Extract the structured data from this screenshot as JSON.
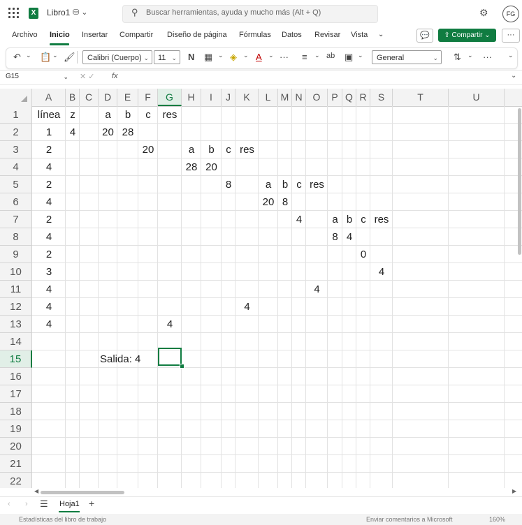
{
  "title_bar": {
    "app_badge": "X",
    "doc_name": "Libro1",
    "doc_status_icons": "⛁ ⌄",
    "search_placeholder": "Buscar herramientas, ayuda y mucho más (Alt + Q)",
    "avatar_initials": "FG"
  },
  "menu": {
    "tabs": [
      "Archivo",
      "Inicio",
      "Insertar",
      "Compartir",
      "Diseño de página",
      "Fórmulas",
      "Datos",
      "Revisar",
      "Vista"
    ],
    "active_tab": "Inicio",
    "share_label": "Compartir",
    "comment_icon": "💬",
    "more_label": "···"
  },
  "ribbon": {
    "font_name": "Calibri (Cuerpo)",
    "font_size": "11",
    "bold_label": "N",
    "number_format": "General",
    "undo_icon": "↶",
    "more_label": "···"
  },
  "formula_bar": {
    "name_box": "G15",
    "cancel_enter_icons": "✕  ✓",
    "fx_label": "fx",
    "content": ""
  },
  "sheet": {
    "columns": [
      "A",
      "B",
      "C",
      "D",
      "E",
      "F",
      "G",
      "H",
      "I",
      "J",
      "K",
      "L",
      "M",
      "N",
      "O",
      "P",
      "Q",
      "R",
      "S",
      "T",
      "U"
    ],
    "rows": [
      "1",
      "2",
      "3",
      "4",
      "5",
      "6",
      "7",
      "8",
      "9",
      "10",
      "11",
      "12",
      "13",
      "14",
      "15",
      "16",
      "17",
      "18",
      "19",
      "20",
      "21",
      "22"
    ],
    "selected_cell": "G15",
    "cells": [
      {
        "ref": "A1",
        "value": "línea"
      },
      {
        "ref": "B1",
        "value": "z"
      },
      {
        "ref": "D1",
        "value": "a"
      },
      {
        "ref": "E1",
        "value": "b"
      },
      {
        "ref": "F1",
        "value": "c"
      },
      {
        "ref": "G1",
        "value": "res"
      },
      {
        "ref": "A2",
        "value": "1"
      },
      {
        "ref": "B2",
        "value": "4"
      },
      {
        "ref": "D2",
        "value": "20"
      },
      {
        "ref": "E2",
        "value": "28"
      },
      {
        "ref": "A3",
        "value": "2"
      },
      {
        "ref": "F3",
        "value": "20"
      },
      {
        "ref": "H3",
        "value": "a"
      },
      {
        "ref": "I3",
        "value": "b"
      },
      {
        "ref": "J3",
        "value": "c"
      },
      {
        "ref": "K3",
        "value": "res"
      },
      {
        "ref": "A4",
        "value": "4"
      },
      {
        "ref": "H4",
        "value": "28"
      },
      {
        "ref": "I4",
        "value": "20"
      },
      {
        "ref": "A5",
        "value": "2"
      },
      {
        "ref": "J5",
        "value": "8"
      },
      {
        "ref": "L5",
        "value": "a"
      },
      {
        "ref": "M5",
        "value": "b"
      },
      {
        "ref": "N5",
        "value": "c"
      },
      {
        "ref": "O5",
        "value": "res"
      },
      {
        "ref": "A6",
        "value": "4"
      },
      {
        "ref": "L6",
        "value": "20"
      },
      {
        "ref": "M6",
        "value": "8"
      },
      {
        "ref": "A7",
        "value": "2"
      },
      {
        "ref": "N7",
        "value": "4"
      },
      {
        "ref": "P7",
        "value": "a"
      },
      {
        "ref": "Q7",
        "value": "b"
      },
      {
        "ref": "R7",
        "value": "c"
      },
      {
        "ref": "S7",
        "value": "res"
      },
      {
        "ref": "A8",
        "value": "4"
      },
      {
        "ref": "P8",
        "value": "8"
      },
      {
        "ref": "Q8",
        "value": "4"
      },
      {
        "ref": "A9",
        "value": "2"
      },
      {
        "ref": "R9",
        "value": "0"
      },
      {
        "ref": "A10",
        "value": "3"
      },
      {
        "ref": "S10",
        "value": "4"
      },
      {
        "ref": "A11",
        "value": "4"
      },
      {
        "ref": "O11",
        "value": "4"
      },
      {
        "ref": "A12",
        "value": "4"
      },
      {
        "ref": "K12",
        "value": "4"
      },
      {
        "ref": "A13",
        "value": "4"
      },
      {
        "ref": "G13",
        "value": "4"
      },
      {
        "ref": "D15",
        "value": "Salida: 4"
      }
    ]
  },
  "sheet_tabs": {
    "prev_icon": "‹",
    "next_icon": "›",
    "all_sheets_icon": "☰",
    "active_sheet": "Hoja1",
    "add_icon": "+"
  },
  "status_bar": {
    "left": "Estadísticas del libro de trabajo",
    "feedback": "Enviar comentarios a Microsoft",
    "zoom": "160%"
  },
  "colors": {
    "accent": "#107c41",
    "header_bg": "#f3f3f3",
    "grid_line": "#e2e2e2"
  }
}
